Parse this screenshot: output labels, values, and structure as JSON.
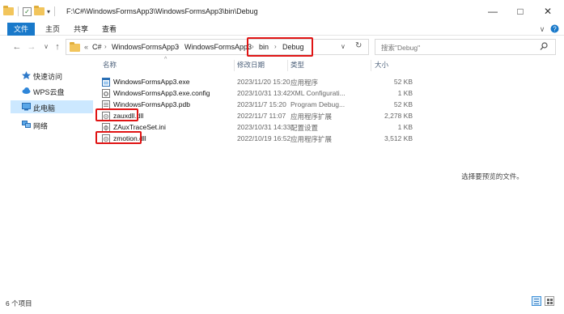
{
  "window": {
    "path_title": "F:\\C#\\WindowsFormsApp3\\WindowsFormsApp3\\bin\\Debug",
    "controls": {
      "minimize": "—",
      "maximize": "□",
      "close": "✕"
    }
  },
  "ribbon": {
    "tabs": [
      "文件",
      "主页",
      "共享",
      "查看"
    ],
    "help_icon": "?",
    "expand_icon": "∨"
  },
  "address": {
    "prefix": "«",
    "crumbs": [
      "C#",
      "WindowsFormsApp3",
      "WindowsFormsApp3",
      "bin",
      "Debug"
    ],
    "dropdown_icon": "∨",
    "refresh_icon": "↻"
  },
  "search": {
    "placeholder": "搜索\"Debug\""
  },
  "nav": {
    "items": [
      {
        "label": "快速访问",
        "icon": "star-icon"
      },
      {
        "label": "WPS云盘",
        "icon": "cloud-icon"
      },
      {
        "label": "此电脑",
        "icon": "computer-icon"
      },
      {
        "label": "网络",
        "icon": "network-icon"
      }
    ]
  },
  "list": {
    "columns": [
      "名称",
      "修改日期",
      "类型",
      "大小"
    ],
    "sort_icon": "^",
    "files": [
      {
        "name": "WindowsFormsApp3.exe",
        "date": "2023/11/20 15:20",
        "type": "应用程序",
        "size": "52 KB",
        "icon": "exe-icon"
      },
      {
        "name": "WindowsFormsApp3.exe.config",
        "date": "2023/10/31 13:42",
        "type": "XML Configurati...",
        "size": "1 KB",
        "icon": "config-icon"
      },
      {
        "name": "WindowsFormsApp3.pdb",
        "date": "2023/11/7 15:20",
        "type": "Program Debug...",
        "size": "52 KB",
        "icon": "pdb-icon"
      },
      {
        "name": "zauxdll.dll",
        "date": "2022/11/7 11:07",
        "type": "应用程序扩展",
        "size": "2,278 KB",
        "icon": "dll-icon"
      },
      {
        "name": "ZAuxTraceSet.ini",
        "date": "2023/10/31 14:33",
        "type": "配置设置",
        "size": "1 KB",
        "icon": "ini-icon"
      },
      {
        "name": "zmotion.dll",
        "date": "2022/10/19 16:52",
        "type": "应用程序扩展",
        "size": "3,512 KB",
        "icon": "dll-icon"
      }
    ]
  },
  "details": {
    "message": "选择要预览的文件。"
  },
  "status": {
    "item_count": "6 个项目"
  },
  "colors": {
    "accent": "#1979ca",
    "highlight": "#e01414",
    "nav_selected": "#cce8ff"
  }
}
